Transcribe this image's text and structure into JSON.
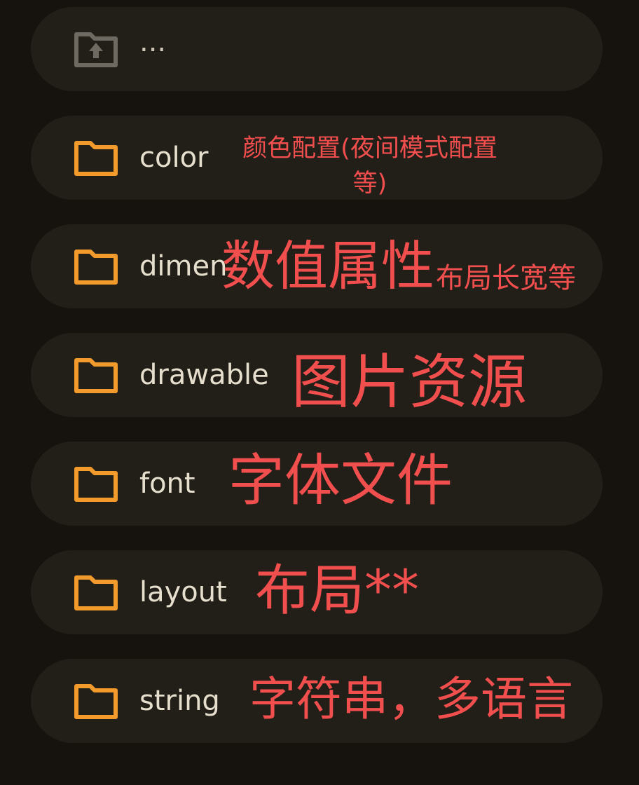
{
  "colors": {
    "background": "#16130e",
    "row": "#221f19",
    "folder_icon": "#f39a2d",
    "parent_icon": "#6e6a62",
    "annotation": "#f14e4e",
    "text": "#e6dfcd"
  },
  "parent": {
    "label": "...",
    "icon": "folder-upload-icon"
  },
  "folders": [
    {
      "name": "color",
      "icon": "folder-icon",
      "note": "颜色配置(夜间模式配置等)"
    },
    {
      "name": "dimen",
      "icon": "folder-icon",
      "note": "数值属性",
      "note_small": "布局长宽等"
    },
    {
      "name": "drawable",
      "icon": "folder-icon",
      "note": "图片资源"
    },
    {
      "name": "font",
      "icon": "folder-icon",
      "note": "字体文件"
    },
    {
      "name": "layout",
      "icon": "folder-icon",
      "note": "布局**"
    },
    {
      "name": "string",
      "icon": "folder-icon",
      "note": "字符串，多语言"
    }
  ]
}
